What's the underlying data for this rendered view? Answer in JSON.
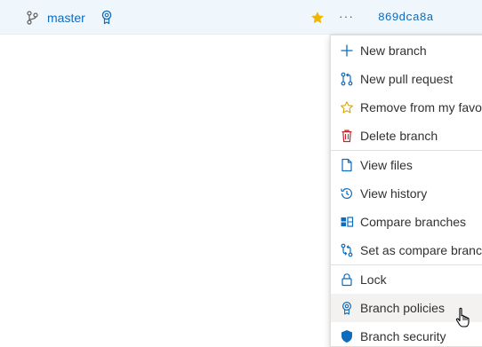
{
  "branch_row": {
    "branch_name": "master",
    "branch_icon": "git-branch-icon",
    "policy_icon": "policy-badge-icon",
    "favorite_icon": "star-filled-icon",
    "more_label": "···",
    "commit_id": "869dca8a"
  },
  "menu": {
    "items": [
      {
        "label": "New branch",
        "icon": "plus-icon"
      },
      {
        "label": "New pull request",
        "icon": "pull-request-icon"
      },
      {
        "label": "Remove from my favorites",
        "icon": "star-outline-icon"
      },
      {
        "label": "Delete branch",
        "icon": "trash-icon"
      },
      {
        "label": "View files",
        "icon": "file-icon"
      },
      {
        "label": "View history",
        "icon": "history-icon"
      },
      {
        "label": "Compare branches",
        "icon": "compare-icon"
      },
      {
        "label": "Set as compare branch",
        "icon": "compare-branch-icon"
      },
      {
        "label": "Lock",
        "icon": "lock-icon"
      },
      {
        "label": "Branch policies",
        "icon": "policy-badge-icon"
      },
      {
        "label": "Branch security",
        "icon": "shield-icon"
      }
    ],
    "hovered_item": "Branch policies"
  },
  "colors": {
    "row_background": "#eff6fc",
    "link": "#0f6cbd",
    "star": "#f2b600",
    "delete": "#c4262e",
    "menu_hover": "#f3f2f1"
  }
}
